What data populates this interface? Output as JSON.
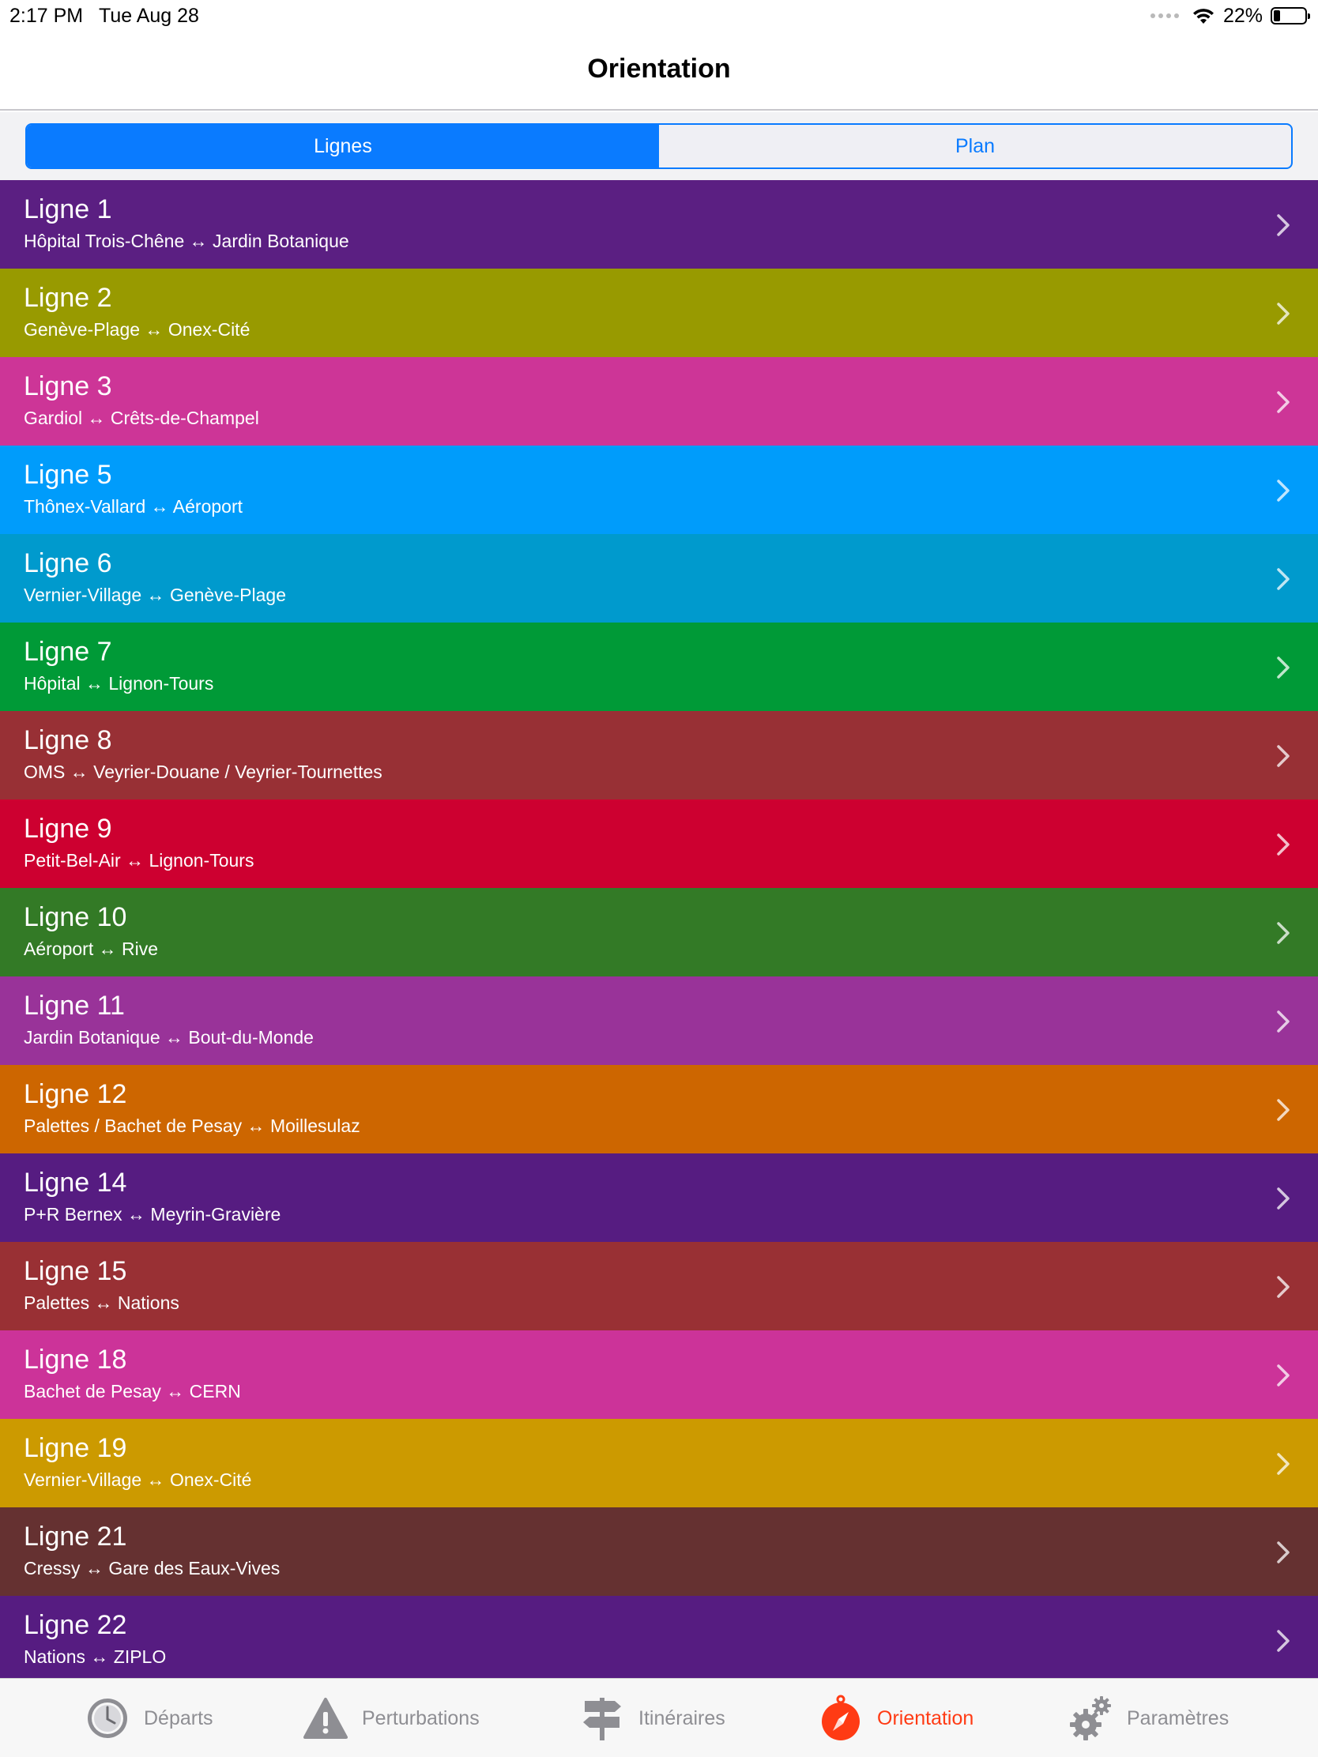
{
  "status": {
    "time": "2:17 PM",
    "date": "Tue Aug 28",
    "battery": "22%",
    "battery_level": 0.22
  },
  "nav": {
    "title": "Orientation"
  },
  "segments": [
    {
      "label": "Lignes",
      "active": true
    },
    {
      "label": "Plan",
      "active": false
    }
  ],
  "lines": [
    {
      "title": "Ligne 1",
      "route": "Hôpital Trois-Chêne ↔ Jardin Botanique",
      "color": "#5b1f82"
    },
    {
      "title": "Ligne 2",
      "route": "Genève-Plage ↔ Onex-Cité",
      "color": "#989a00"
    },
    {
      "title": "Ligne 3",
      "route": "Gardiol ↔ Crêts-de-Champel",
      "color": "#cd3597"
    },
    {
      "title": "Ligne 5",
      "route": "Thônex-Vallard ↔ Aéroport",
      "color": "#009cfb"
    },
    {
      "title": "Ligne 6",
      "route": "Vernier-Village ↔ Genève-Plage",
      "color": "#009acd"
    },
    {
      "title": "Ligne 7",
      "route": "Hôpital ↔ Lignon-Tours",
      "color": "#009a37"
    },
    {
      "title": "Ligne 8",
      "route": "OMS ↔ Veyrier-Douane / Veyrier-Tournettes",
      "color": "#983035"
    },
    {
      "title": "Ligne 9",
      "route": "Petit-Bel-Air ↔ Lignon-Tours",
      "color": "#cd0030"
    },
    {
      "title": "Ligne 10",
      "route": "Aéroport ↔ Rive",
      "color": "#337a26"
    },
    {
      "title": "Ligne 11",
      "route": "Jardin Botanique ↔ Bout-du-Monde",
      "color": "#993399"
    },
    {
      "title": "Ligne 12",
      "route": "Palettes / Bachet de Pesay ↔ Moillesulaz",
      "color": "#cd6600"
    },
    {
      "title": "Ligne 14",
      "route": "P+R Bernex ↔ Meyrin-Gravière",
      "color": "#561c81"
    },
    {
      "title": "Ligne 15",
      "route": "Palettes ↔ Nations",
      "color": "#993034"
    },
    {
      "title": "Ligne 18",
      "route": "Bachet de Pesay ↔ CERN",
      "color": "#cc3399"
    },
    {
      "title": "Ligne 19",
      "route": "Vernier-Village ↔ Onex-Cité",
      "color": "#cc9a00"
    },
    {
      "title": "Ligne 21",
      "route": "Cressy ↔ Gare des Eaux-Vives",
      "color": "#653131"
    },
    {
      "title": "Ligne 22",
      "route": "Nations ↔ ZIPLO",
      "color": "#561c81"
    }
  ],
  "tabs": [
    {
      "label": "Départs",
      "icon": "clock-icon",
      "active": false
    },
    {
      "label": "Perturbations",
      "icon": "warning-icon",
      "active": false
    },
    {
      "label": "Itinéraires",
      "icon": "signpost-icon",
      "active": false
    },
    {
      "label": "Orientation",
      "icon": "compass-icon",
      "active": true
    },
    {
      "label": "Paramètres",
      "icon": "gears-icon",
      "active": false
    }
  ]
}
